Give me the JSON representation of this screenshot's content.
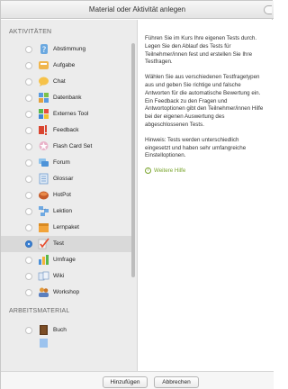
{
  "dialog": {
    "title": "Material oder Aktivität anlegen"
  },
  "sections": {
    "activities": "AKTIVITÄTEN",
    "resources": "ARBEITSMATERIAL"
  },
  "activities": [
    {
      "label": "Abstimmung",
      "icon": "poll-icon",
      "checked": false
    },
    {
      "label": "Aufgabe",
      "icon": "assignment-icon",
      "checked": false
    },
    {
      "label": "Chat",
      "icon": "chat-icon",
      "checked": false
    },
    {
      "label": "Datenbank",
      "icon": "database-icon",
      "checked": false
    },
    {
      "label": "Externes Tool",
      "icon": "puzzle-icon",
      "checked": false
    },
    {
      "label": "Feedback",
      "icon": "feedback-icon",
      "checked": false
    },
    {
      "label": "Flash Card Set",
      "icon": "flashcard-icon",
      "checked": false
    },
    {
      "label": "Forum",
      "icon": "forum-icon",
      "checked": false
    },
    {
      "label": "Glossar",
      "icon": "glossary-icon",
      "checked": false
    },
    {
      "label": "HotPot",
      "icon": "hotpot-icon",
      "checked": false
    },
    {
      "label": "Lektion",
      "icon": "lesson-icon",
      "checked": false
    },
    {
      "label": "Lernpaket",
      "icon": "package-icon",
      "checked": false
    },
    {
      "label": "Test",
      "icon": "quiz-icon",
      "checked": true
    },
    {
      "label": "Umfrage",
      "icon": "survey-icon",
      "checked": false
    },
    {
      "label": "Wiki",
      "icon": "wiki-icon",
      "checked": false
    },
    {
      "label": "Workshop",
      "icon": "workshop-icon",
      "checked": false
    }
  ],
  "resources": [
    {
      "label": "Buch",
      "icon": "book-icon",
      "checked": false
    }
  ],
  "description": {
    "p1": [
      "Führen Sie im Kurs Ihre eigenen Tests durch.",
      "Legen Sie den Ablauf des Tests für",
      "Teilnehmer/innen fest und erstellen Sie Ihre",
      "Testfragen."
    ],
    "p2": [
      "Wählen Sie aus verschiedenen Testfragetypen",
      "aus und geben Sie richtige und falsche",
      "Antworten für die automatische Bewertung ein.",
      "Ein Feedback zu den Fragen und",
      "Antwortoptionen gibt den Teilnehmer/innen Hilfe",
      "bei der eigenen Auswertung des",
      "abgeschlossenen Tests."
    ],
    "p3": [
      "Hinweis: Tests werden unterschiedlich",
      "eingesetzt und haben sehr umfangreiche",
      "Einstelloptionen."
    ],
    "more_help": "Weitere Hilfe"
  },
  "footer": {
    "add_label": "Hinzufügen",
    "cancel_label": "Abbrechen"
  },
  "colors": {
    "accent": "#3b82d6",
    "help_link": "#7aa52e",
    "pane_bg": "#ececec"
  }
}
